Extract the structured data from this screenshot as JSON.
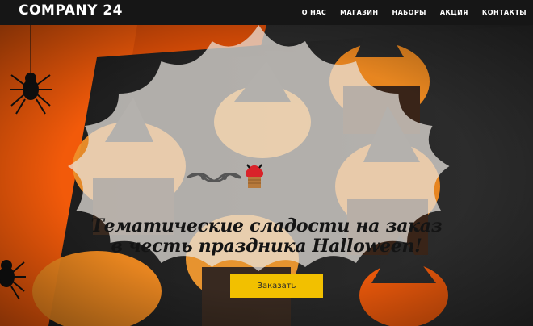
{
  "header": {
    "logo": "COMPANY 24",
    "nav": [
      {
        "label": "О НАС"
      },
      {
        "label": "МАГАЗИН"
      },
      {
        "label": "НАБОРЫ"
      },
      {
        "label": "АКЦИЯ"
      },
      {
        "label": "КОНТАКТЫ"
      }
    ]
  },
  "hero": {
    "headline_line1": "Тематические сладости на заказ",
    "headline_line2": "в честь праздника Halloween!",
    "cta_label": "Заказать",
    "decor_icons": [
      "spider-icon",
      "cupcake-icon",
      "swirl-ornament-icon"
    ]
  },
  "colors": {
    "header_bg": "#161616",
    "accent_orange": "#f25a0a",
    "cta_yellow": "#f2c000"
  }
}
